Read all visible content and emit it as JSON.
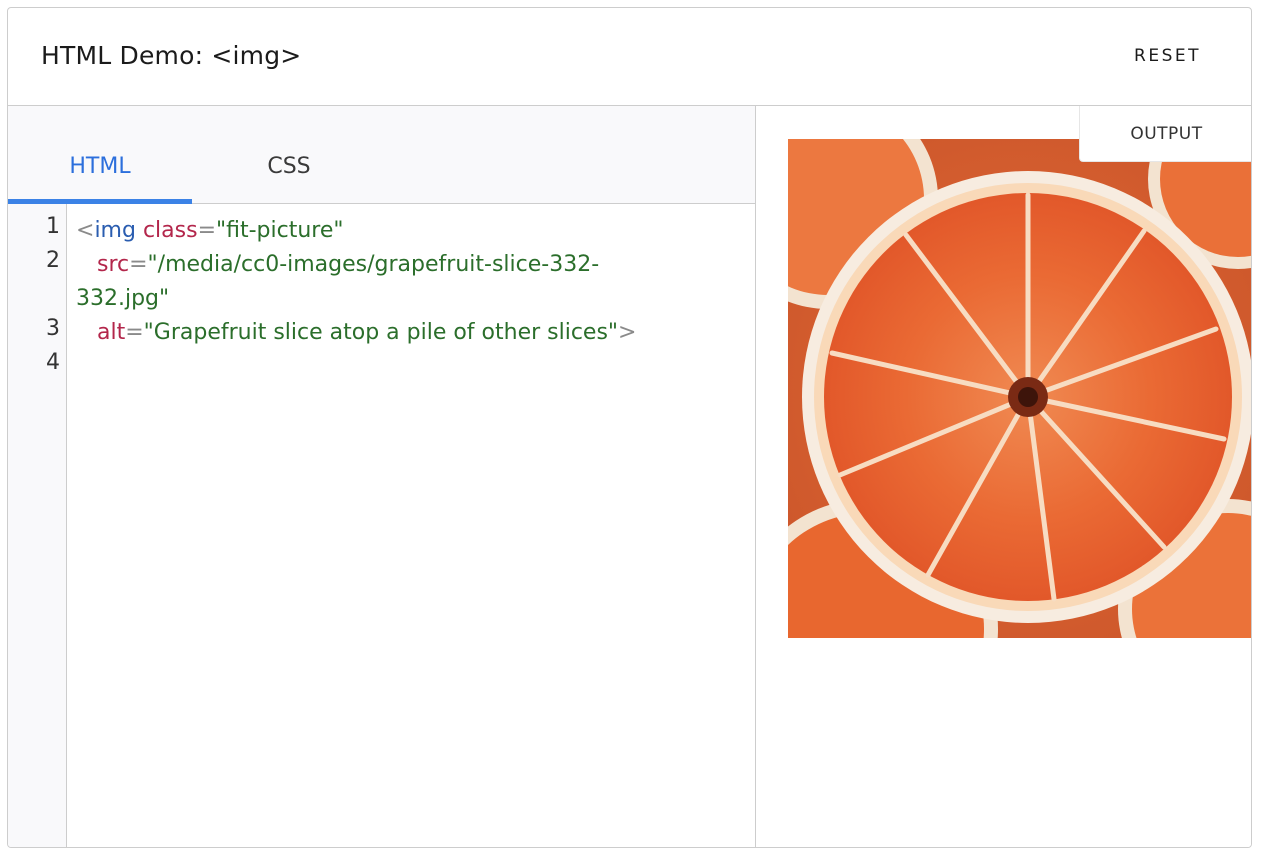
{
  "header": {
    "title": "HTML Demo: <img>",
    "reset_label": "RESET"
  },
  "tabs": [
    {
      "label": "HTML",
      "active": true
    },
    {
      "label": "CSS",
      "active": false
    }
  ],
  "editor": {
    "line_numbers": [
      "1",
      "2",
      "3",
      "4"
    ],
    "lines": [
      {
        "parts": [
          {
            "t": "punct",
            "v": "<"
          },
          {
            "t": "tag",
            "v": "img"
          },
          {
            "t": "text",
            "v": " "
          },
          {
            "t": "attr",
            "v": "class"
          },
          {
            "t": "punct",
            "v": "="
          },
          {
            "t": "str",
            "v": "\"fit-picture\""
          }
        ]
      },
      {
        "parts": [
          {
            "t": "text",
            "v": "   "
          },
          {
            "t": "attr",
            "v": "src"
          },
          {
            "t": "punct",
            "v": "="
          },
          {
            "t": "str",
            "v": "\"/media/cc0-images/grapefruit-slice-332-"
          }
        ]
      },
      {
        "parts": [
          {
            "t": "str",
            "v": "332.jpg\""
          }
        ]
      },
      {
        "parts": [
          {
            "t": "text",
            "v": "   "
          },
          {
            "t": "attr",
            "v": "alt"
          },
          {
            "t": "punct",
            "v": "="
          },
          {
            "t": "str",
            "v": "\"Grapefruit slice atop a pile of other slices\""
          },
          {
            "t": "punct",
            "v": ">"
          }
        ]
      }
    ]
  },
  "output": {
    "label": "OUTPUT",
    "image_alt": "Grapefruit slice atop a pile of other slices"
  },
  "colors": {
    "accent": "#3b82e6",
    "tag": "#2a5db0",
    "attr": "#b3264b",
    "string": "#2b6e2b"
  }
}
